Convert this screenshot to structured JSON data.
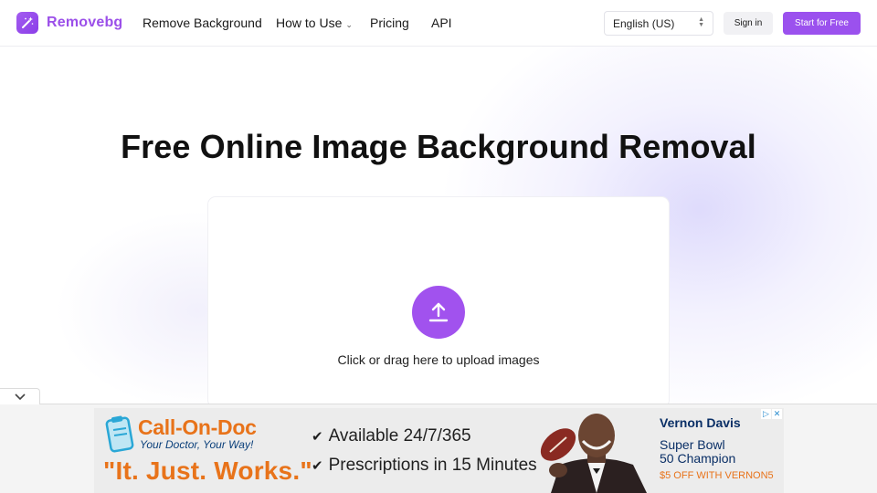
{
  "header": {
    "brand": "Removebg",
    "nav": [
      {
        "label": "Remove Background"
      },
      {
        "label": "How to Use"
      },
      {
        "label": "Pricing"
      },
      {
        "label": "API"
      }
    ],
    "language": "English (US)",
    "signin_label": "Sign in",
    "start_label": "Start for Free"
  },
  "hero": {
    "title": "Free Online Image Background Removal",
    "upload_text": "Click or drag here to upload images"
  },
  "ad": {
    "brand": "Call-On-Doc",
    "tagline": "Your Doctor, Your Way!",
    "slogan": "\"It. Just. Works.\"",
    "bullets": [
      "Available 24/7/365",
      "Prescriptions in 15 Minutes"
    ],
    "person_name": "Vernon Davis",
    "person_line1": "Super Bowl",
    "person_line2": "50 Champion",
    "offer": "$5 OFF WITH VERNON5"
  },
  "colors": {
    "accent": "#9b51ee",
    "ad_orange": "#e8731a",
    "ad_navy": "#0a2f66"
  },
  "icons": {
    "logo": "magic-wand-icon",
    "upload": "upload-arrow-icon",
    "collapse": "chevron-down-icon",
    "language": "select-arrows-icon",
    "ad_choices": "ad-choices-icon"
  }
}
